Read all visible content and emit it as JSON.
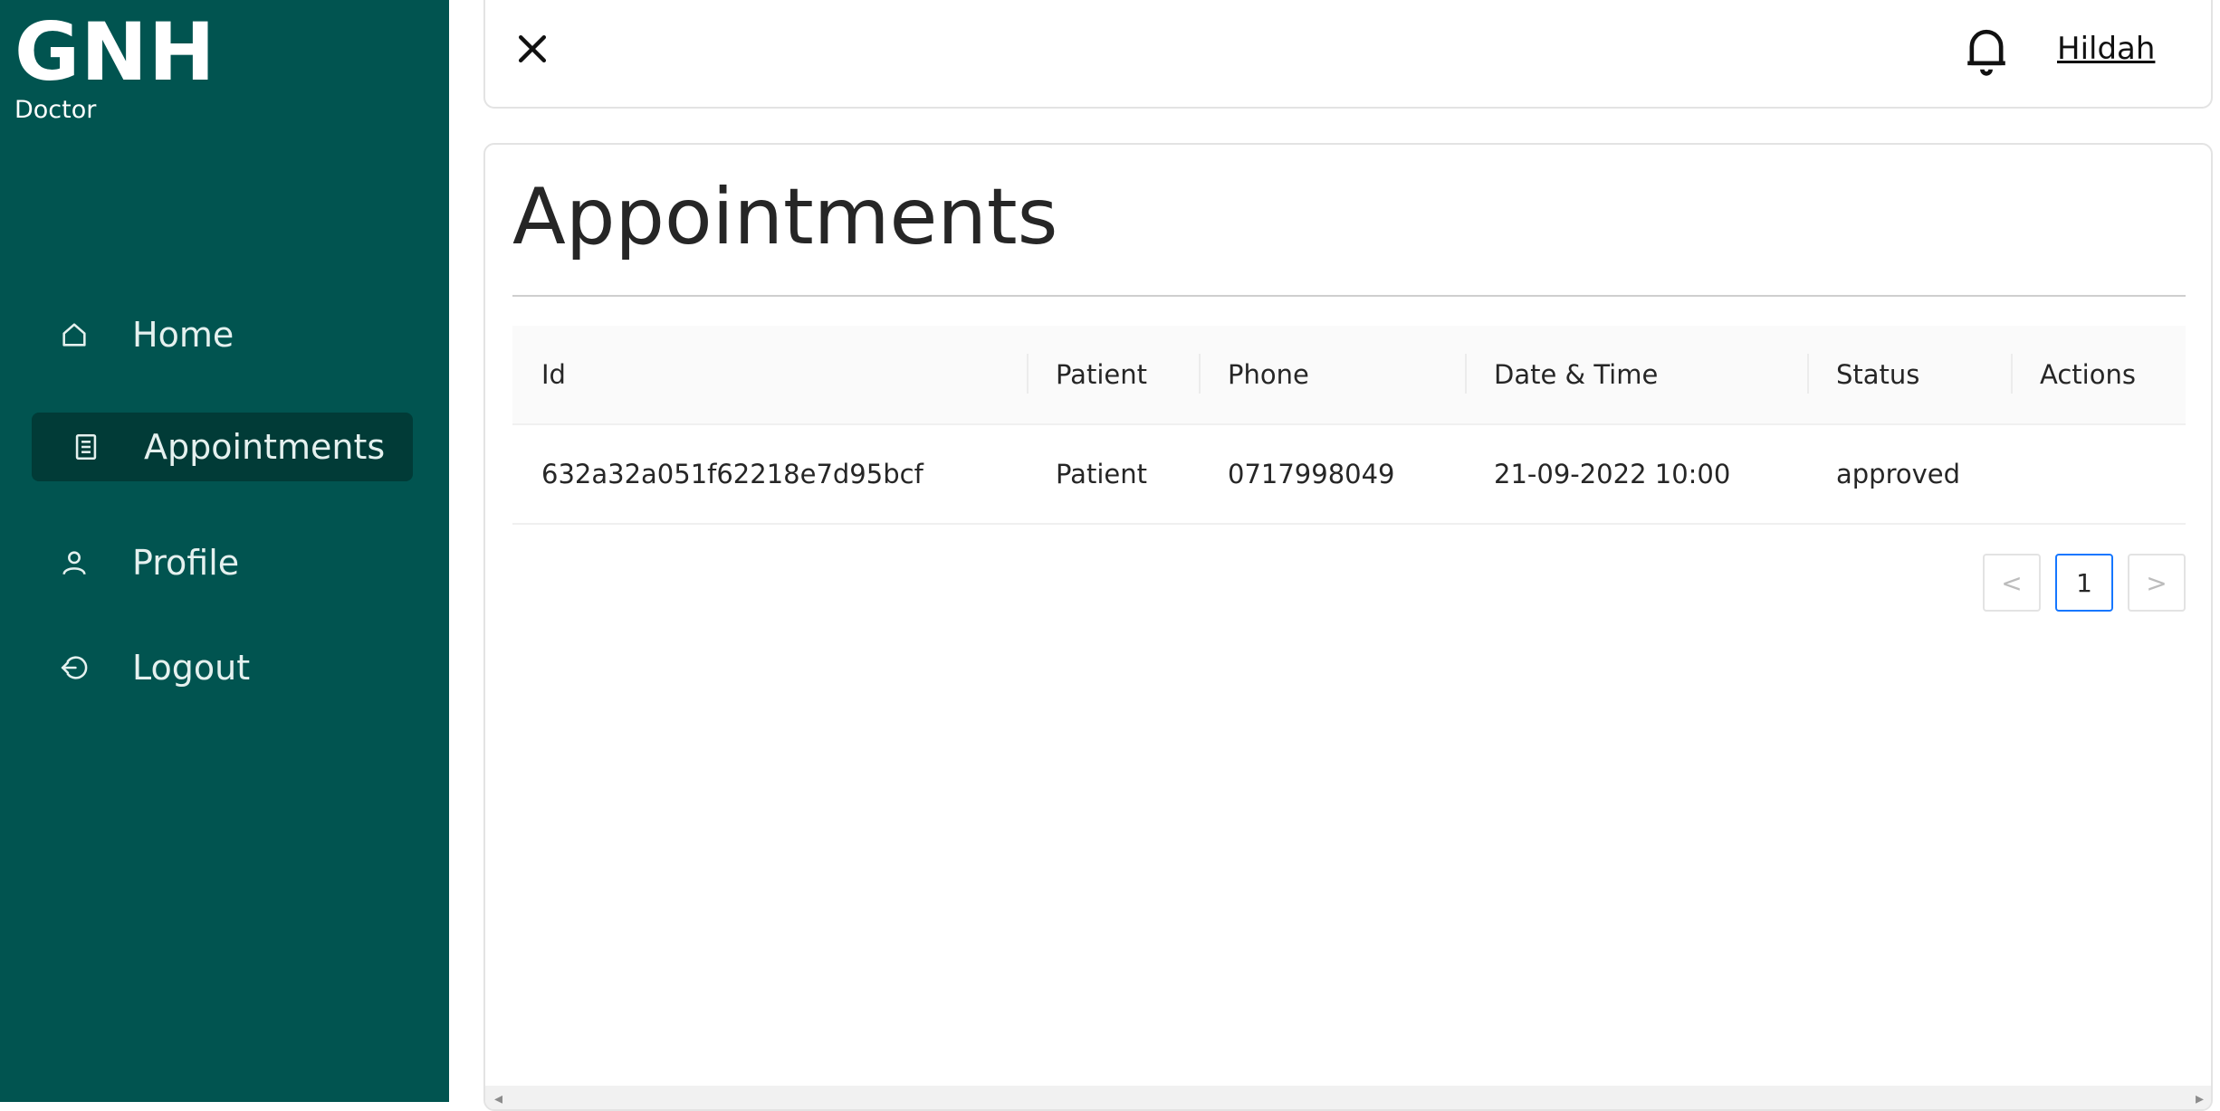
{
  "sidebar": {
    "brand": "GNH",
    "role": "Doctor",
    "items": [
      {
        "label": "Home",
        "icon": "home-icon"
      },
      {
        "label": "Appointments",
        "icon": "document-icon",
        "active": true
      },
      {
        "label": "Profile",
        "icon": "user-icon"
      },
      {
        "label": "Logout",
        "icon": "logout-icon"
      }
    ]
  },
  "header": {
    "close_icon": "close-icon",
    "bell_icon": "bell-icon",
    "user_name": "Hildah"
  },
  "main": {
    "title": "Appointments",
    "table": {
      "columns": [
        "Id",
        "Patient",
        "Phone",
        "Date & Time",
        "Status",
        "Actions"
      ],
      "rows": [
        {
          "id": "632a32a051f62218e7d95bcf",
          "patient": "Patient",
          "phone": "0717998049",
          "datetime": "21-09-2022 10:00",
          "status": "approved",
          "actions": ""
        }
      ]
    },
    "pagination": {
      "prev": "<",
      "current": "1",
      "next": ">"
    },
    "scrollbar": {
      "left": "◂",
      "right": "▸"
    }
  },
  "colors": {
    "sidebar_bg": "#015450",
    "sidebar_active_bg": "#013b37",
    "pagination_active_border": "#1677ff"
  }
}
